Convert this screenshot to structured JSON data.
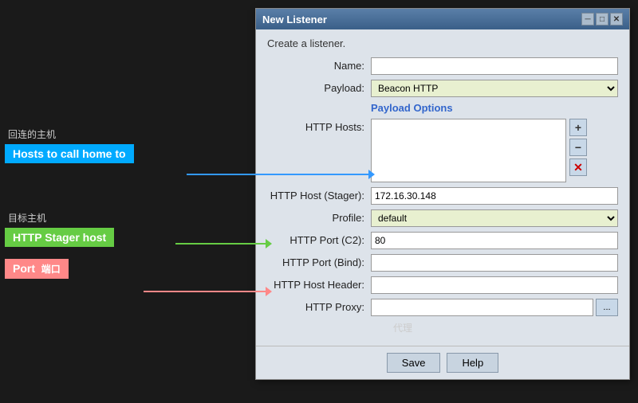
{
  "annotations": {
    "hosts_chinese": "回连的主机",
    "hosts_label": "Hosts to call home to",
    "stager_chinese": "目标主机",
    "stager_label": "HTTP Stager host",
    "port_label": "Port",
    "port_chinese": "端口",
    "proxy_chinese": "代理"
  },
  "dialog": {
    "title": "New Listener",
    "subtitle": "Create a listener.",
    "name_label": "Name:",
    "payload_label": "Payload:",
    "payload_value": "Beacon HTTP",
    "payload_options_label": "Payload Options",
    "http_hosts_label": "HTTP Hosts:",
    "http_host_stager_label": "HTTP Host (Stager):",
    "http_host_stager_value": "172.16.30.148",
    "profile_label": "Profile:",
    "profile_value": "default",
    "http_port_c2_label": "HTTP Port (C2):",
    "http_port_c2_value": "80",
    "http_port_bind_label": "HTTP Port (Bind):",
    "http_host_header_label": "HTTP Host Header:",
    "http_proxy_label": "HTTP Proxy:",
    "save_label": "Save",
    "help_label": "Help",
    "btn_plus": "+",
    "btn_minus": "−",
    "btn_x": "✕",
    "btn_dots": "...",
    "btn_minimize": "─",
    "btn_maximize": "□",
    "btn_close": "✕"
  }
}
